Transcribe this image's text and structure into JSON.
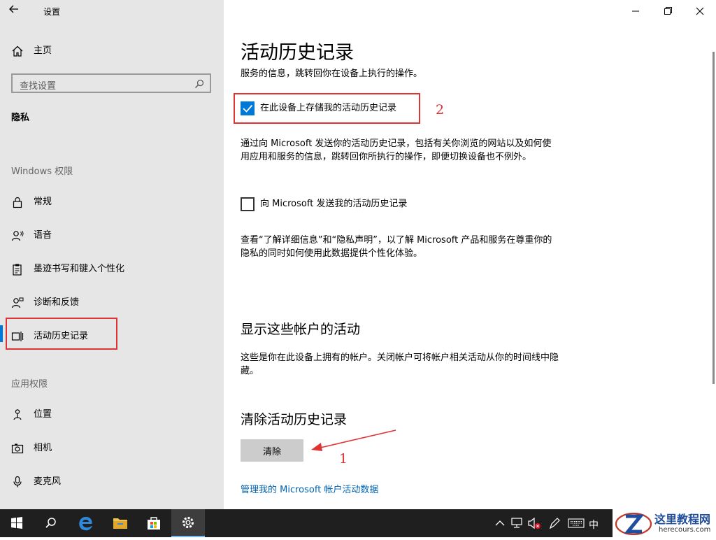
{
  "window": {
    "title": "设置",
    "back_icon": "arrow-left-icon",
    "controls": [
      "minimize-icon",
      "restore-icon",
      "close-icon"
    ]
  },
  "sidebar": {
    "home_label": "主页",
    "search_placeholder": "查找设置",
    "category_title": "隐私",
    "windows_section": "Windows 权限",
    "windows_items": [
      {
        "label": "常规",
        "icon": "lock-icon"
      },
      {
        "label": "语音",
        "icon": "speech-person-icon"
      },
      {
        "label": "墨迹书写和键入个性化",
        "icon": "clipboard-pen-icon"
      },
      {
        "label": "诊断和反馈",
        "icon": "feedback-person-icon"
      },
      {
        "label": "活动历史记录",
        "icon": "activity-history-icon",
        "selected": true
      }
    ],
    "app_section": "应用权限",
    "app_items": [
      {
        "label": "位置",
        "icon": "location-person-icon"
      },
      {
        "label": "相机",
        "icon": "camera-icon"
      },
      {
        "label": "麦克风",
        "icon": "microphone-icon"
      }
    ],
    "accent_color": "#0078d7"
  },
  "main": {
    "title": "活动历史记录",
    "intro": "服务的信息，跳转回你在设备上执行的操作。",
    "store_checkbox": {
      "label": "在此设备上存储我的活动历史记录",
      "checked": true
    },
    "send_desc": "通过向 Microsoft 发送你的活动历史记录，包括有关你浏览的网站以及如何使用应用和服务的信息，跳转回你所执行的操作，即便切换设备也不例外。",
    "send_checkbox": {
      "label": "向 Microsoft 发送我的活动历史记录",
      "checked": false
    },
    "privacy_text": "查看“了解详细信息”和“隐私声明”，以了解 Microsoft 产品和服务在尊重你的隐私的同时如何使用此数据提供个性化体验。",
    "accounts_heading": "显示这些帐户的活动",
    "accounts_desc": "这些是你在此设备上拥有的帐户。关闭帐户可将帐户相关活动从你的时间线中隐藏。",
    "clear_heading": "清除活动历史记录",
    "clear_button": "清除",
    "manage_link": "管理我的 Microsoft 帐户活动数据"
  },
  "annotations": {
    "label1": "1",
    "label2": "2",
    "color": "#e03333"
  },
  "taskbar": {
    "items": [
      "windows-start-icon",
      "search-icon",
      "edge-browser-icon",
      "file-explorer-icon",
      "store-icon",
      "settings-gear-icon"
    ],
    "tray_ime": "中",
    "tray_icons": [
      "chevron-up-icon",
      "network-icon",
      "volume-muted-icon",
      "pen-icon",
      "keyboard-icon"
    ]
  },
  "watermark": {
    "title": "这里教程网",
    "url": "herecours.com"
  }
}
